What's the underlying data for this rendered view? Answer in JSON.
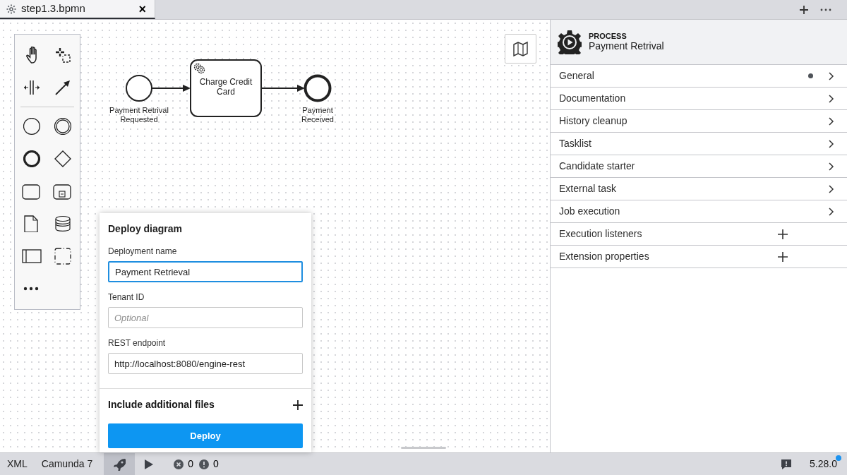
{
  "tabs": [
    {
      "title": "step1.3.bpmn",
      "selected": true,
      "closable": true,
      "close_label": "×"
    }
  ],
  "diagram": {
    "nodes": [
      {
        "kind": "start",
        "label": "Payment Retrival Requested"
      },
      {
        "kind": "service_task",
        "label": "Charge Credit Card"
      },
      {
        "kind": "end",
        "label": "Payment Received"
      }
    ]
  },
  "palette": [
    {
      "tools": [
        {
          "kind": "hand"
        },
        {
          "kind": "lasso"
        },
        {
          "kind": "space"
        },
        {
          "kind": "connect"
        }
      ]
    },
    {
      "tools": [
        {
          "kind": "start"
        },
        {
          "kind": "intermediate"
        },
        {
          "kind": "end"
        },
        {
          "kind": "gateway"
        },
        {
          "kind": "task"
        },
        {
          "kind": "subprocess"
        },
        {
          "kind": "data_object"
        },
        {
          "kind": "data_store"
        },
        {
          "kind": "pool"
        },
        {
          "kind": "group"
        },
        {
          "kind": "more"
        }
      ]
    }
  ],
  "deploy": {
    "title": "Deploy diagram",
    "fields": [
      {
        "label": "Deployment name",
        "value": "Payment Retrieval",
        "focused": true
      },
      {
        "label": "Tenant ID",
        "placeholder": "Optional",
        "focused": false
      },
      {
        "label": "REST endpoint",
        "value": "http://localhost:8080/engine-rest",
        "focused": false
      }
    ],
    "include_label": "Include additional files",
    "button": "Deploy"
  },
  "properties": {
    "type": "PROCESS",
    "name": "Payment Retrival",
    "groups": [
      {
        "label": "General",
        "kind": "expand",
        "has_entries": true
      },
      {
        "label": "Documentation",
        "kind": "expand",
        "has_entries": false
      },
      {
        "label": "History cleanup",
        "kind": "expand",
        "has_entries": false
      },
      {
        "label": "Tasklist",
        "kind": "expand",
        "has_entries": false
      },
      {
        "label": "Candidate starter",
        "kind": "expand",
        "has_entries": false
      },
      {
        "label": "External task",
        "kind": "expand",
        "has_entries": false
      },
      {
        "label": "Job execution",
        "kind": "expand",
        "has_entries": false
      },
      {
        "label": "Execution listeners",
        "kind": "add",
        "has_entries": false
      },
      {
        "label": "Extension properties",
        "kind": "add",
        "has_entries": false
      }
    ]
  },
  "status_bar": {
    "format": "XML",
    "engine": "Camunda 7",
    "deploy_selected": true,
    "errors": "0",
    "warnings": "0",
    "version": "5.28.0",
    "update_available": true
  }
}
